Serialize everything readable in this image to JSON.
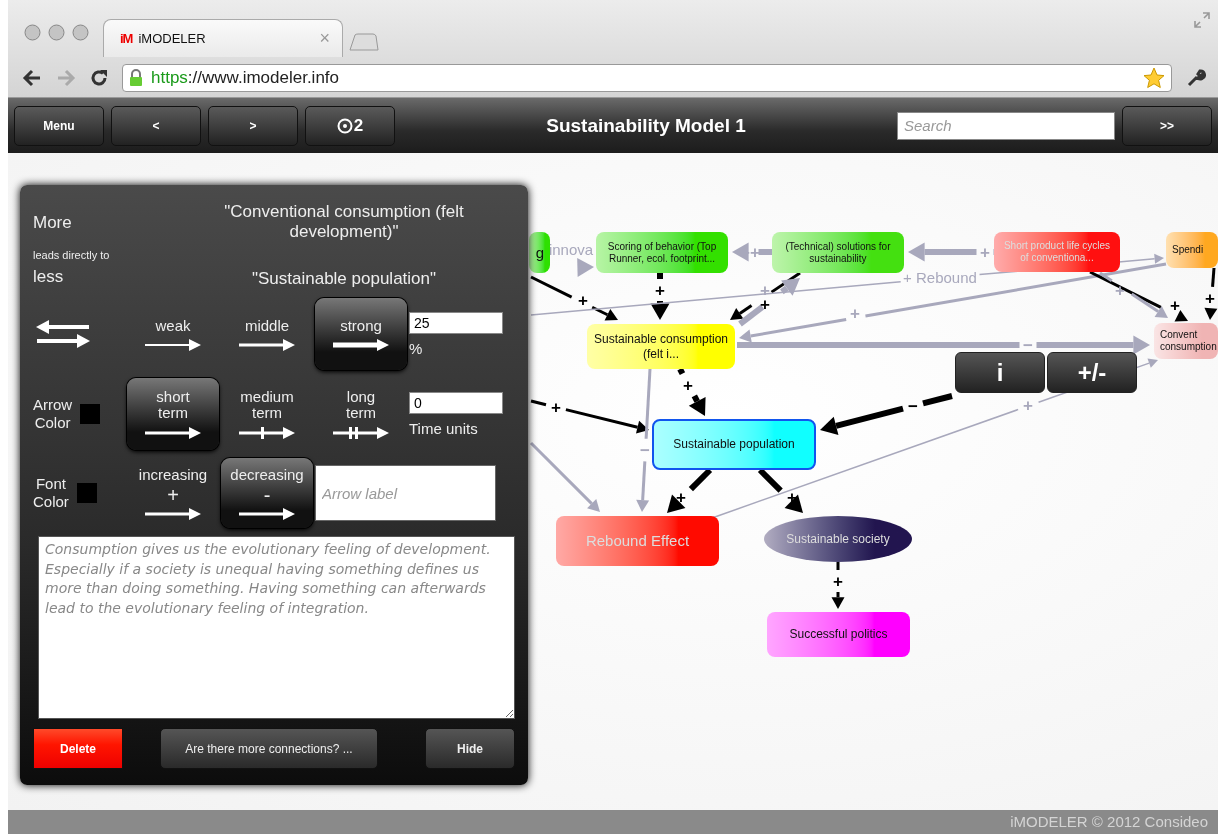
{
  "browser": {
    "tab": {
      "logo": "iM",
      "title": "iMODELER",
      "close": "×"
    },
    "url": {
      "scheme": "https",
      "address": "://www.imodeler.info"
    }
  },
  "toolbar": {
    "buttons": [
      {
        "label": "Menu",
        "kind": "text"
      },
      {
        "label": "<",
        "kind": "text"
      },
      {
        "label": ">",
        "kind": "text"
      },
      {
        "label": "2",
        "kind": "target"
      }
    ],
    "title": "Sustainability Model 1",
    "search": {
      "placeholder": "Search"
    },
    "more": ">>"
  },
  "canvas": {
    "nodes": [
      {
        "label": "g",
        "color": "#2ee000",
        "kind": "box",
        "selected": false
      },
      {
        "label": "Scoring of behavior (Top Runner, ecol. footprint...",
        "color": "#33e000",
        "kind": "box",
        "selected": false
      },
      {
        "label": "(Technical) solutions for sustainability",
        "color": "#44e010",
        "kind": "box",
        "selected": false
      },
      {
        "label": "Short product life cycles of conventiona...",
        "color": "#ff1010",
        "kind": "box",
        "selected": false
      },
      {
        "label": "Spendi",
        "color": "#ffa820",
        "kind": "box",
        "selected": false
      },
      {
        "label": "Sustainable consumption (felt i...",
        "color": "#ffff00",
        "kind": "box",
        "selected": false
      },
      {
        "label": "Convent consumption",
        "color": "#f0b4b4",
        "kind": "box",
        "selected": false
      },
      {
        "label": "Sustainable population",
        "color": "#10ffff",
        "kind": "box",
        "selected": true
      },
      {
        "label": "Rebound Effect",
        "color": "#ff0a00",
        "kind": "box",
        "selected": false
      },
      {
        "label": "Sustainable society",
        "color": "#22154f",
        "kind": "ellipse",
        "selected": false
      },
      {
        "label": "Successful politics",
        "color": "#ff00ff",
        "kind": "box",
        "selected": false
      }
    ],
    "edges": [
      {
        "sign": "+",
        "highlighted": true,
        "kind": "middle"
      },
      {
        "sign": "+",
        "highlighted": true,
        "kind": "strong"
      },
      {
        "sign": "+",
        "highlighted": true,
        "kind": "middle"
      },
      {
        "sign": "+",
        "highlighted": false,
        "kind": "strong"
      },
      {
        "sign": "++",
        "highlighted": false,
        "kind": "strong"
      },
      {
        "sign": "+",
        "highlighted": false,
        "kind": "strong"
      },
      {
        "sign": "+ Rebound",
        "highlighted": false,
        "kind": "weak"
      },
      {
        "sign": "+",
        "highlighted": false,
        "kind": "middle"
      },
      {
        "sign": "−",
        "highlighted": false,
        "kind": "strong"
      },
      {
        "sign": "+",
        "highlighted": true,
        "kind": "middle"
      },
      {
        "sign": "+",
        "highlighted": true,
        "kind": "middle"
      },
      {
        "sign": "+",
        "highlighted": true,
        "kind": "strong"
      },
      {
        "sign": "+",
        "highlighted": true,
        "kind": "middle"
      },
      {
        "sign": "−",
        "highlighted": true,
        "kind": "strong"
      },
      {
        "sign": "−",
        "highlighted": false,
        "kind": "middle"
      },
      {
        "highlighted": false,
        "kind": "middle"
      },
      {
        "sign": "+",
        "highlighted": true,
        "kind": "strong"
      },
      {
        "sign": "+",
        "highlighted": true,
        "kind": "strong"
      },
      {
        "sign": "+",
        "highlighted": false,
        "kind": "weak"
      },
      {
        "sign": "+",
        "highlighted": true,
        "kind": "middle"
      },
      {
        "sign": "+",
        "highlighted": false,
        "kind": "middle"
      },
      {
        "sign": "innova",
        "highlighted": false,
        "kind": "strong"
      }
    ],
    "node_buttons": [
      {
        "label": "i"
      },
      {
        "label": "+/-"
      }
    ]
  },
  "link_panel": {
    "more_label": "More",
    "relation": "leads directly to",
    "less_label": "less",
    "source": "\"Conventional consumption (felt development)\"",
    "target": "\"Sustainable population\"",
    "strength_options": [
      {
        "label": "weak",
        "kind": "weak",
        "selected": false
      },
      {
        "label": "middle",
        "kind": "middle",
        "selected": false
      },
      {
        "label": "strong",
        "kind": "strong",
        "selected": true
      }
    ],
    "strength_value": "25",
    "strength_unit": "%",
    "arrow_color": {
      "label": "Arrow Color",
      "color": "#000000"
    },
    "delay_options": [
      {
        "label": "short term",
        "kind": "short",
        "selected": true
      },
      {
        "label": "medium term",
        "kind": "medium",
        "selected": false
      },
      {
        "label": "long term",
        "kind": "long",
        "selected": false
      }
    ],
    "delay_value": "0",
    "delay_unit": "Time units",
    "font_color": {
      "label": "Font Color",
      "color": "#000000"
    },
    "direction_options": [
      {
        "label": "increasing",
        "sign": "+",
        "selected": false
      },
      {
        "label": "decreasing",
        "sign": "-",
        "selected": true
      }
    ],
    "arrow_label": {
      "placeholder": "Arrow label"
    },
    "description": "Consumption gives us the evolutionary feeling of development. Especially if a society is unequal having something defines us more than doing something. Having something can afterwards lead to the evolutionary feeling of integration.",
    "buttons": [
      {
        "label": "Delete",
        "kind": "danger"
      },
      {
        "label": "Are there more connections? ...",
        "kind": "normal"
      },
      {
        "label": "Hide",
        "kind": "normal"
      }
    ]
  },
  "footer": "iMODELER © 2012 Consideo"
}
